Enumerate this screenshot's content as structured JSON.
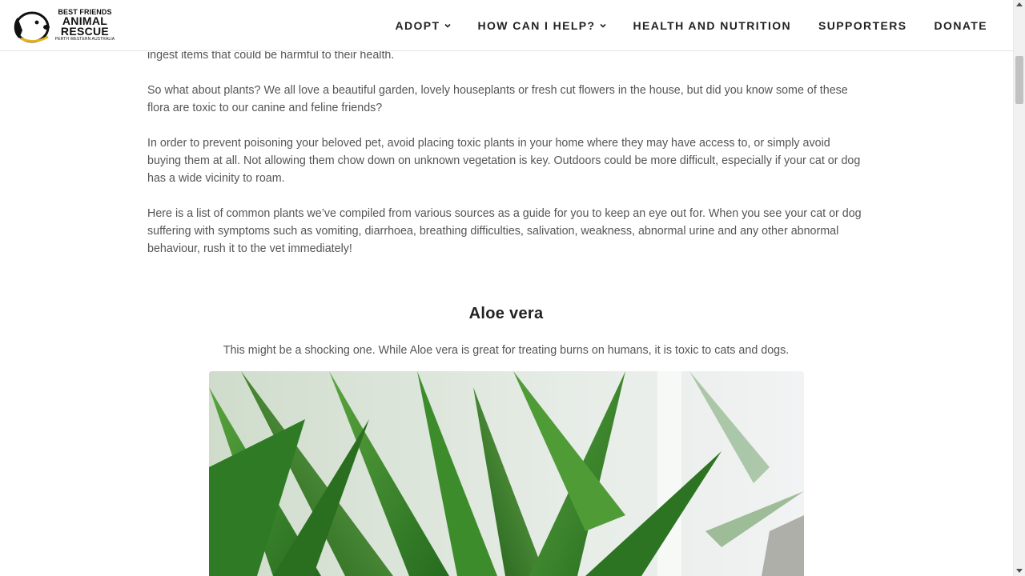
{
  "brand": {
    "line1": "BEST FRIENDS",
    "line2": "ANIMAL",
    "line3": "RESCUE",
    "line4": "PERTH WESTERN AUSTRALIA",
    "logo_icon": "dog-head-icon"
  },
  "nav": {
    "items": [
      {
        "label": "ADOPT",
        "has_dropdown": true
      },
      {
        "label": "HOW CAN I HELP?",
        "has_dropdown": true
      },
      {
        "label": "HEALTH AND NUTRITION",
        "has_dropdown": false
      },
      {
        "label": "SUPPORTERS",
        "has_dropdown": false
      },
      {
        "label": "DONATE",
        "has_dropdown": false
      }
    ]
  },
  "article": {
    "paragraphs": [
      "ingest items that could be harmful to their health.",
      "So what about plants? We all love a beautiful garden, lovely houseplants or fresh cut flowers in the house, but did you know some of these flora are toxic to our canine and feline friends?",
      "In order to prevent poisoning your beloved pet, avoid placing toxic plants in your home where they may have access to, or simply avoid buying them at all. Not allowing them chow down on unknown vegetation is key. Outdoors could be more difficult, especially if your cat or dog has a wide vicinity to roam.",
      "Here is a list of common plants we’ve compiled from various sources as a guide for you to keep an eye out for. When you see your cat or dog suffering with symptoms such as vomiting, diarrhoea, breathing difficulties, salivation, weakness, abnormal urine and any other abnormal behaviour, rush it to the vet immediately!"
    ]
  },
  "plant": {
    "title": "Aloe vera",
    "description": "This might be a shocking one. While Aloe vera is great for treating burns on humans, it is toxic to cats and dogs."
  },
  "colors": {
    "text": "#555555",
    "heading": "#222222",
    "nav_text": "#222222",
    "plant_green": "#3f8a2c"
  }
}
